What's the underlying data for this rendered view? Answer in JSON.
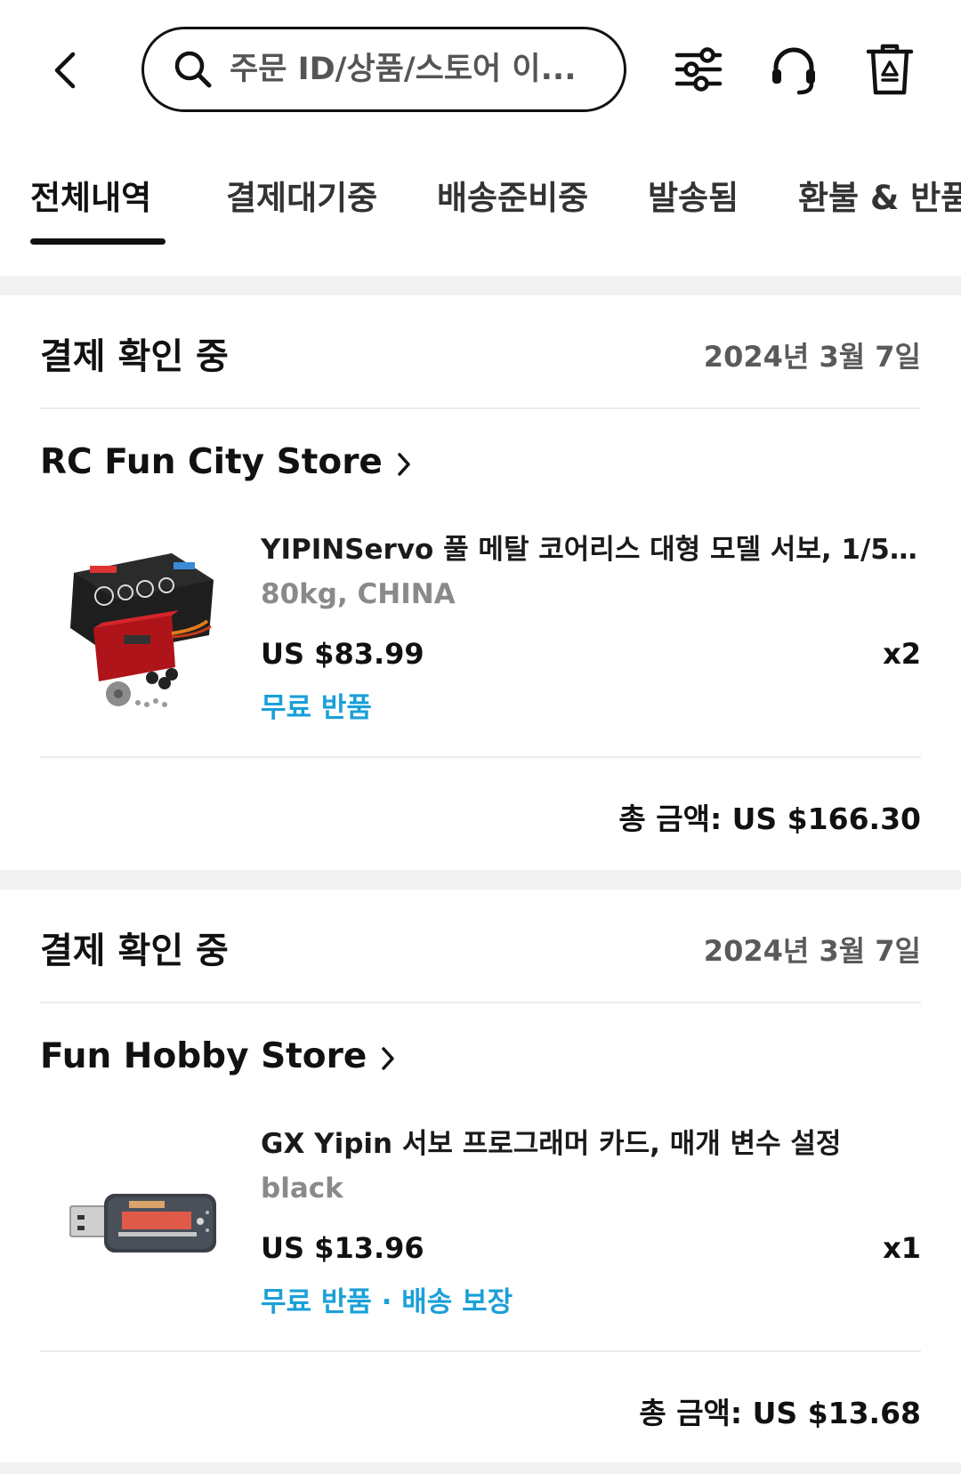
{
  "header": {
    "search_placeholder": "주문 ID/상품/스토어 이..."
  },
  "tabs": [
    {
      "label": "전체내역",
      "active": true
    },
    {
      "label": "결제대기중",
      "active": false
    },
    {
      "label": "배송준비중",
      "active": false
    },
    {
      "label": "발송됨",
      "active": false
    },
    {
      "label": "환불 & 반품",
      "active": false
    }
  ],
  "orders": [
    {
      "status": "결제 확인 중",
      "date": "2024년 3월 7일",
      "store": "RC Fun City Store",
      "item": {
        "title": "YIPINServo 풀 메탈 코어리스 대형 모델 서보, 1/5 1/...",
        "variant": "80kg, CHINA",
        "price": "US $83.99",
        "quantity": "x2",
        "benefits": "무료 반품"
      },
      "total": "총 금액: US $166.30"
    },
    {
      "status": "결제 확인 중",
      "date": "2024년 3월 7일",
      "store": "Fun Hobby Store",
      "item": {
        "title": "GX Yipin 서보 프로그래머 카드, 매개 변수 설정",
        "variant": "black",
        "price": "US $13.96",
        "quantity": "x1",
        "benefits": "무료 반품 · 배송 보장"
      },
      "total": "총 금액: US $13.68"
    }
  ],
  "colors": {
    "accent_link": "#1aa0d8",
    "background": "#f2f2f2",
    "card": "#ffffff",
    "muted_text": "#8a8a8a"
  },
  "icons": {
    "back": "chevron-left-icon",
    "search": "search-icon",
    "filter": "sliders-icon",
    "support": "headset-icon",
    "recycle": "recycle-bin-icon",
    "store_chevron": "chevron-right-icon"
  }
}
